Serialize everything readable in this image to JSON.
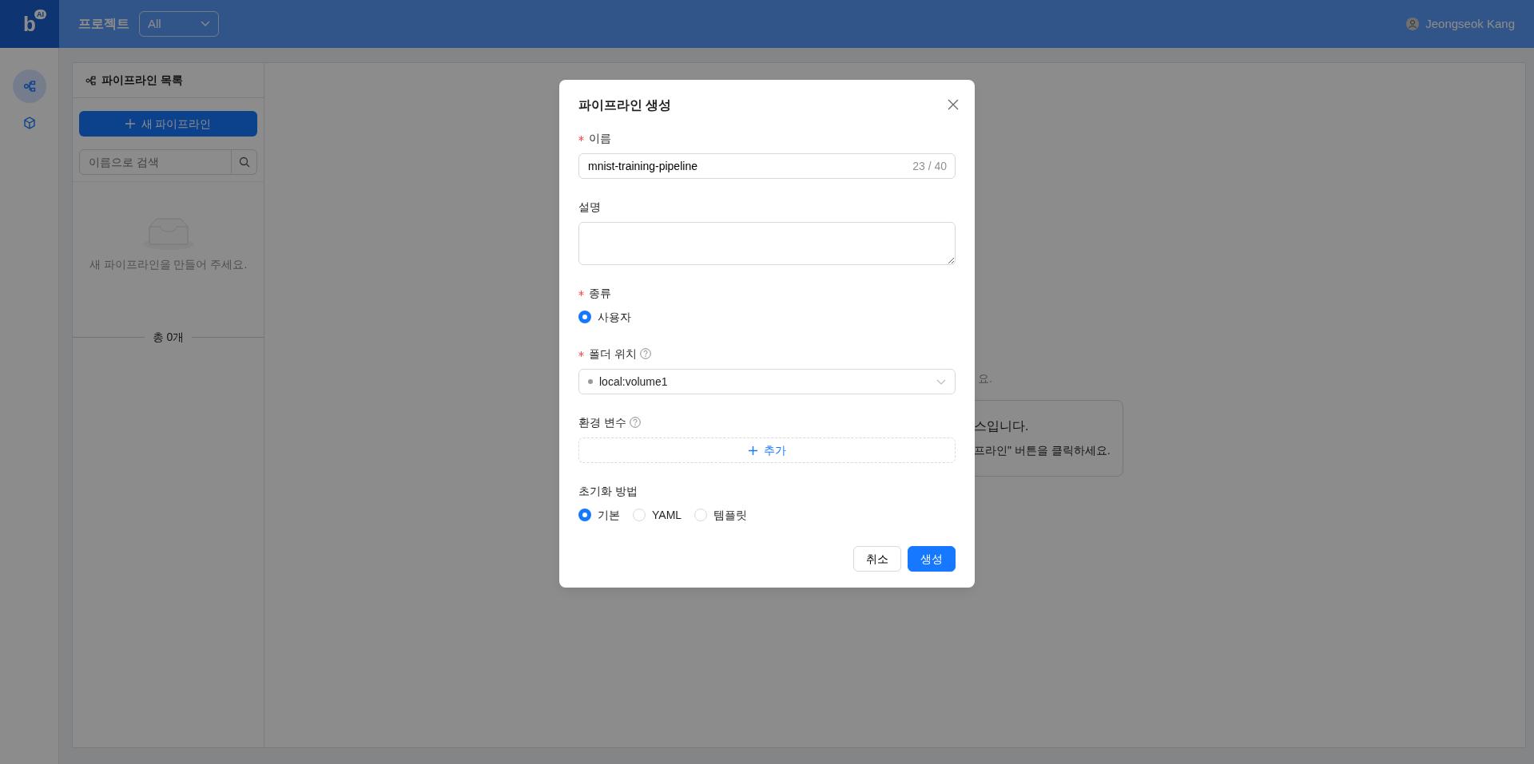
{
  "header": {
    "logo": "b",
    "logo_badge": "AI",
    "project_label": "프로젝트",
    "project_select": "All",
    "user": "Jeongseok Kang"
  },
  "rail": [
    {
      "kind": "pipeline",
      "selected": true
    },
    {
      "kind": "cube",
      "selected": false
    }
  ],
  "panel": {
    "title": "파이프라인 목록",
    "new_button": "새 파이프라인",
    "search_placeholder": "이름으로 검색",
    "empty_text": "새 파이프라인을 만들어 주세요.",
    "total": "총 0개"
  },
  "background": {
    "hint": "요.",
    "card_title": "스입니다.",
    "card_text": "프라인\" 버튼을 클릭하세요."
  },
  "modal": {
    "title": "파이프라인 생성",
    "name": {
      "label": "이름",
      "required": true,
      "value": "mnist-training-pipeline",
      "counter": "23 / 40"
    },
    "description": {
      "label": "설명",
      "required": false
    },
    "type": {
      "label": "종류",
      "required": true,
      "options": [
        {
          "label": "사용자",
          "selected": true
        }
      ]
    },
    "folder": {
      "label": "폴더 위치",
      "required": true,
      "help": true,
      "value": "local:volume1"
    },
    "env": {
      "label": "환경 변수",
      "required": false,
      "help": true,
      "add_button": "추가"
    },
    "init": {
      "label": "초기화 방법",
      "required": false,
      "options": [
        {
          "label": "기본",
          "selected": true
        },
        {
          "label": "YAML",
          "selected": false
        },
        {
          "label": "템플릿",
          "selected": false
        }
      ]
    },
    "buttons": [
      {
        "label": "취소",
        "kind": "default"
      },
      {
        "label": "생성",
        "kind": "primary"
      }
    ]
  }
}
